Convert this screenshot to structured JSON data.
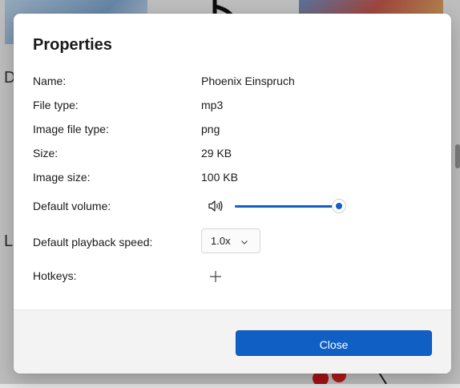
{
  "background": {
    "letters": [
      "D",
      "L"
    ]
  },
  "dialog": {
    "title": "Properties",
    "fields": [
      {
        "label": "Name:",
        "value": "Phoenix Einspruch"
      },
      {
        "label": "File type:",
        "value": "mp3"
      },
      {
        "label": "Image file type:",
        "value": "png"
      },
      {
        "label": "Size:",
        "value": "29 KB"
      },
      {
        "label": "Image size:",
        "value": "100 KB"
      }
    ],
    "volume": {
      "label": "Default volume:",
      "level": 1.0,
      "icon": "speaker-icon"
    },
    "speed": {
      "label": "Default playback speed:",
      "selected": "1.0x",
      "icon": "chevron-down-icon"
    },
    "hotkeys": {
      "label": "Hotkeys:",
      "add_icon": "plus-icon"
    },
    "close_label": "Close"
  },
  "colors": {
    "accent": "#0f5fc4"
  }
}
